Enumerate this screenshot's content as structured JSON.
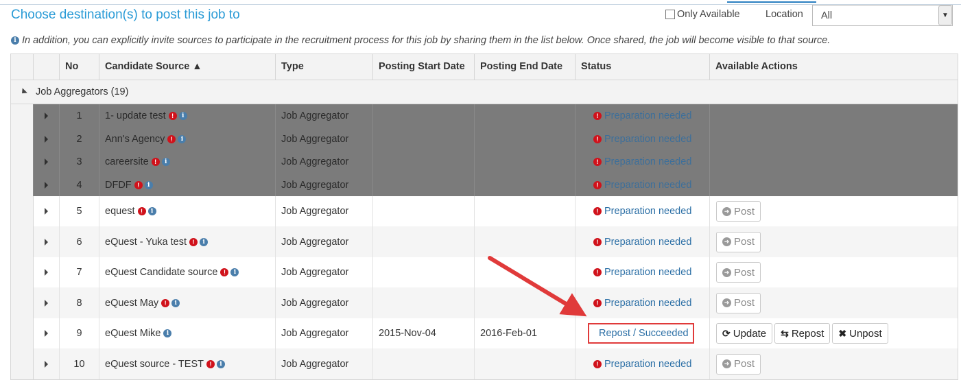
{
  "page": {
    "title": "Choose destination(s) to post this job to",
    "only_available_label": "Only Available",
    "location_label": "Location",
    "location_value": "All",
    "info_text": "In addition, you can explicitly invite sources to participate in the recruitment process for this job by sharing them in the list below. Once shared, the job will become visible to that source."
  },
  "table": {
    "columns": [
      "No",
      "Candidate Source ▲",
      "Type",
      "Posting Start Date",
      "Posting End Date",
      "Status",
      "Available Actions"
    ],
    "group_label": "Job Aggregators (19)",
    "rows": [
      {
        "no": "1",
        "source": "1- update test",
        "type": "Job Aggregator",
        "start": "",
        "end": "",
        "status": "Preparation needed",
        "warn": true,
        "actions": [],
        "style": "gray"
      },
      {
        "no": "2",
        "source": "Ann's Agency",
        "type": "Job Aggregator",
        "start": "",
        "end": "",
        "status": "Preparation needed",
        "warn": true,
        "actions": [],
        "style": "gray"
      },
      {
        "no": "3",
        "source": "careersite",
        "type": "Job Aggregator",
        "start": "",
        "end": "",
        "status": "Preparation needed",
        "warn": true,
        "actions": [],
        "style": "gray"
      },
      {
        "no": "4",
        "source": "DFDF",
        "type": "Job Aggregator",
        "start": "",
        "end": "",
        "status": "Preparation needed",
        "warn": true,
        "actions": [],
        "style": "gray"
      },
      {
        "no": "5",
        "source": "equest",
        "type": "Job Aggregator",
        "start": "",
        "end": "",
        "status": "Preparation needed",
        "warn": true,
        "actions": [
          "Post"
        ],
        "style": "white"
      },
      {
        "no": "6",
        "source": "eQuest - Yuka test",
        "type": "Job Aggregator",
        "start": "",
        "end": "",
        "status": "Preparation needed",
        "warn": true,
        "actions": [
          "Post"
        ],
        "style": "alt"
      },
      {
        "no": "7",
        "source": "eQuest Candidate source",
        "type": "Job Aggregator",
        "start": "",
        "end": "",
        "status": "Preparation needed",
        "warn": true,
        "actions": [
          "Post"
        ],
        "style": "white"
      },
      {
        "no": "8",
        "source": "eQuest May",
        "type": "Job Aggregator",
        "start": "",
        "end": "",
        "status": "Preparation needed",
        "warn": true,
        "actions": [
          "Post"
        ],
        "style": "alt"
      },
      {
        "no": "9",
        "source": "eQuest Mike",
        "type": "Job Aggregator",
        "start": "2015-Nov-04",
        "end": "2016-Feb-01",
        "status": "Repost / Succeeded",
        "warn": false,
        "actions": [
          "Update",
          "Repost",
          "Unpost"
        ],
        "style": "white"
      },
      {
        "no": "10",
        "source": "eQuest source - TEST",
        "type": "Job Aggregator",
        "start": "",
        "end": "",
        "status": "Preparation needed",
        "warn": true,
        "actions": [
          "Post"
        ],
        "style": "alt"
      }
    ]
  },
  "colors": {
    "title": "#2a9bd6",
    "link": "#2a6ea5",
    "warn": "#d0121b",
    "highlight": "#e03a3a",
    "gray_row": "#7b7b7b"
  }
}
